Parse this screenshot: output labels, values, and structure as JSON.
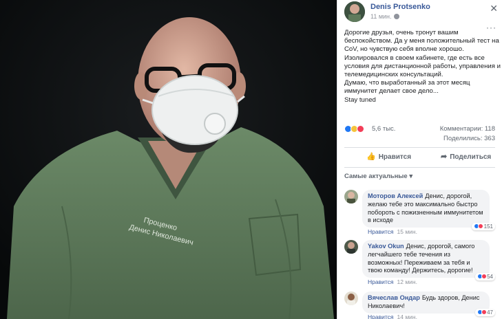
{
  "post": {
    "author": "Denis Protsenko",
    "time": "11 мин.",
    "text": "Дорогие друзья, очень тронут вашим беспокойством. Да у меня положительный тест на CoV, но чувствую себя вполне хорошо.\nИзолировался в своем кабинете, где есть все условия для дистанционной работы, управления и телемедицинских консультаций.\nДумаю, что выработанный за этот месяц иммунитет делает свое дело...\nStay tuned",
    "reactions_count": "5,6 тыс.",
    "comments_label": "Комментарии: 118",
    "shares_label": "Поделились: 363"
  },
  "photo": {
    "scrubs_text_line1": "Проценко",
    "scrubs_text_line2": "Денис Николаевич"
  },
  "actions": {
    "like_label": "Нравится",
    "share_label": "Поделиться"
  },
  "comments_sort": "Самые актуальные",
  "comments": [
    {
      "name": "Моторов Алексей",
      "text": "Денис, дорогой, желаю тебе это максимально быстро побороть с пожизненным иммунитетом в исходе",
      "like_label": "Нравится",
      "time": "15 мин.",
      "reactions": "151"
    },
    {
      "name": "Yakov Okun",
      "text": "Денис, дорогой, самого легчайшего тебе течения из возможных! Переживаем за тебя и твою команду! Держитесь, дорогие!",
      "like_label": "Нравится",
      "time": "12 мин.",
      "reactions": "54"
    },
    {
      "name": "Вячеслав Ондар",
      "text": "Будь здоров, Денис Николаевич!",
      "like_label": "Нравится",
      "time": "14 мин.",
      "reactions": "47"
    }
  ],
  "colors": {
    "link_blue": "#385898",
    "scrubs_green": "#5f7a5c",
    "background_dark": "#0f1112"
  },
  "icons": [
    "close-icon",
    "more-icon",
    "globe-icon",
    "like-icon",
    "share-icon",
    "chevron-down-icon"
  ]
}
